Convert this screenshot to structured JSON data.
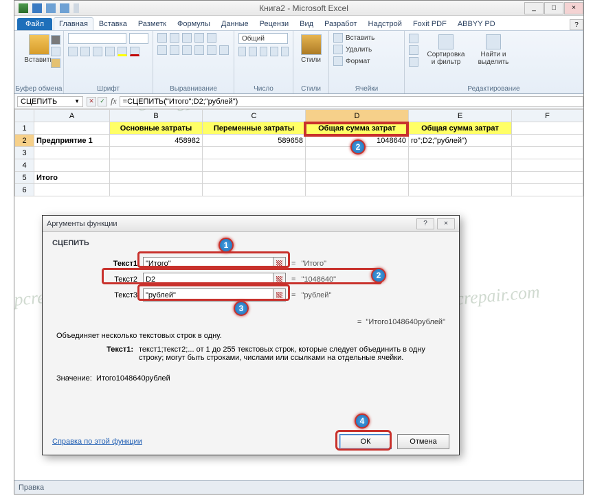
{
  "window": {
    "title": "Книга2 - Microsoft Excel",
    "min": "_",
    "max": "□",
    "close": "×",
    "help": "?"
  },
  "ribbon": {
    "file": "Файл",
    "tabs": [
      "Главная",
      "Вставка",
      "Разметк",
      "Формулы",
      "Данные",
      "Рецензи",
      "Вид",
      "Разработ",
      "Надстрой",
      "Foxit PDF",
      "ABBYY PD"
    ],
    "active_index": 0,
    "groups": {
      "clipboard": "Буфер обмена",
      "paste": "Вставить",
      "font": "Шрифт",
      "align": "Выравнивание",
      "number": "Число",
      "number_fmt": "Общий",
      "styles": "Стили",
      "styles_btn": "Стили",
      "cells": "Ячейки",
      "cells_insert": "Вставить",
      "cells_delete": "Удалить",
      "cells_format": "Формат",
      "editing": "Редактирование",
      "sort": "Сортировка и фильтр",
      "find": "Найти и выделить"
    }
  },
  "fx": {
    "namebox": "СЦЕПИТЬ",
    "cancel": "✕",
    "enter": "✓",
    "fx": "fx",
    "formula": "=СЦЕПИТЬ(\"Итого\";D2;\"рублей\")"
  },
  "grid": {
    "cols": [
      "A",
      "B",
      "C",
      "D",
      "E",
      "F"
    ],
    "headers": {
      "B": "Основные затраты",
      "C": "Переменные затраты",
      "D": "Общая сумма затрат",
      "E": "Общая сумма затрат"
    },
    "rows": [
      {
        "r": "1"
      },
      {
        "r": "2",
        "A": "Предприятие 1",
        "B": "458982",
        "C": "589658",
        "D": "1048640",
        "E": "го\";D2;\"рублей\")"
      },
      {
        "r": "3"
      },
      {
        "r": "4"
      },
      {
        "r": "5",
        "A": "Итого"
      },
      {
        "r": "6"
      }
    ],
    "selected_col": "D",
    "selected_row": "2"
  },
  "dialog": {
    "title": "Аргументы функции",
    "func": "СЦЕПИТЬ",
    "args": [
      {
        "label": "Текст1",
        "value": "\"Итого\"",
        "result": "\"Итого\"",
        "bold": true
      },
      {
        "label": "Текст2",
        "value": "D2",
        "result": "\"1048640\"",
        "bold": false
      },
      {
        "label": "Текст3",
        "value": "\"рублей\"",
        "result": "\"рублей\"",
        "bold": false
      }
    ],
    "preview_eq": "=",
    "preview": "\"Итого1048640рублей\"",
    "desc1": "Объединяет несколько текстовых строк в одну.",
    "arghelp_label": "Текст1:",
    "arghelp": "текст1;текст2;... от 1 до 255 текстовых строк, которые следует объединить в одну строку; могут быть строками, числами или ссылками на отдельные ячейки.",
    "value_label": "Значение:",
    "value": "Итого1048640рублей",
    "help": "Справка по этой функции",
    "ok": "ОК",
    "cancel": "Отмена"
  },
  "status": {
    "mode": "Правка"
  },
  "watermark": "Soringpcrepair.com"
}
